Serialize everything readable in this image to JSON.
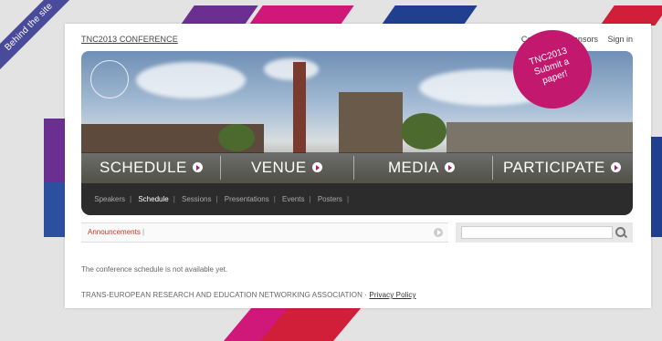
{
  "corner_ribbon": "Behind the site",
  "header": {
    "site_title": "TNC2013 CONFERENCE",
    "links": [
      "Contacts",
      "Sponsors",
      "Sign in"
    ]
  },
  "banner": {
    "nav": [
      "SCHEDULE",
      "VENUE",
      "MEDIA",
      "PARTICIPATE"
    ],
    "badge": {
      "line1": "TNC2013",
      "line2": "Submit a",
      "line3": "paper!"
    }
  },
  "subnav": {
    "items": [
      "Speakers",
      "Schedule",
      "Sessions",
      "Presentations",
      "Events",
      "Posters"
    ],
    "active": "Schedule"
  },
  "announcements": {
    "label": "Announcements"
  },
  "search": {
    "value": ""
  },
  "content": {
    "message": "The conference schedule is not available yet."
  },
  "footer": {
    "org": "TRANS-EUROPEAN RESEARCH AND EDUCATION NETWORKING ASSOCIATION",
    "separator": "·",
    "privacy": "Privacy Policy"
  },
  "colors": {
    "accent": "#c2186d",
    "purple": "#5b2d8e",
    "blue": "#1f3a8a",
    "red": "#d11f3a"
  }
}
